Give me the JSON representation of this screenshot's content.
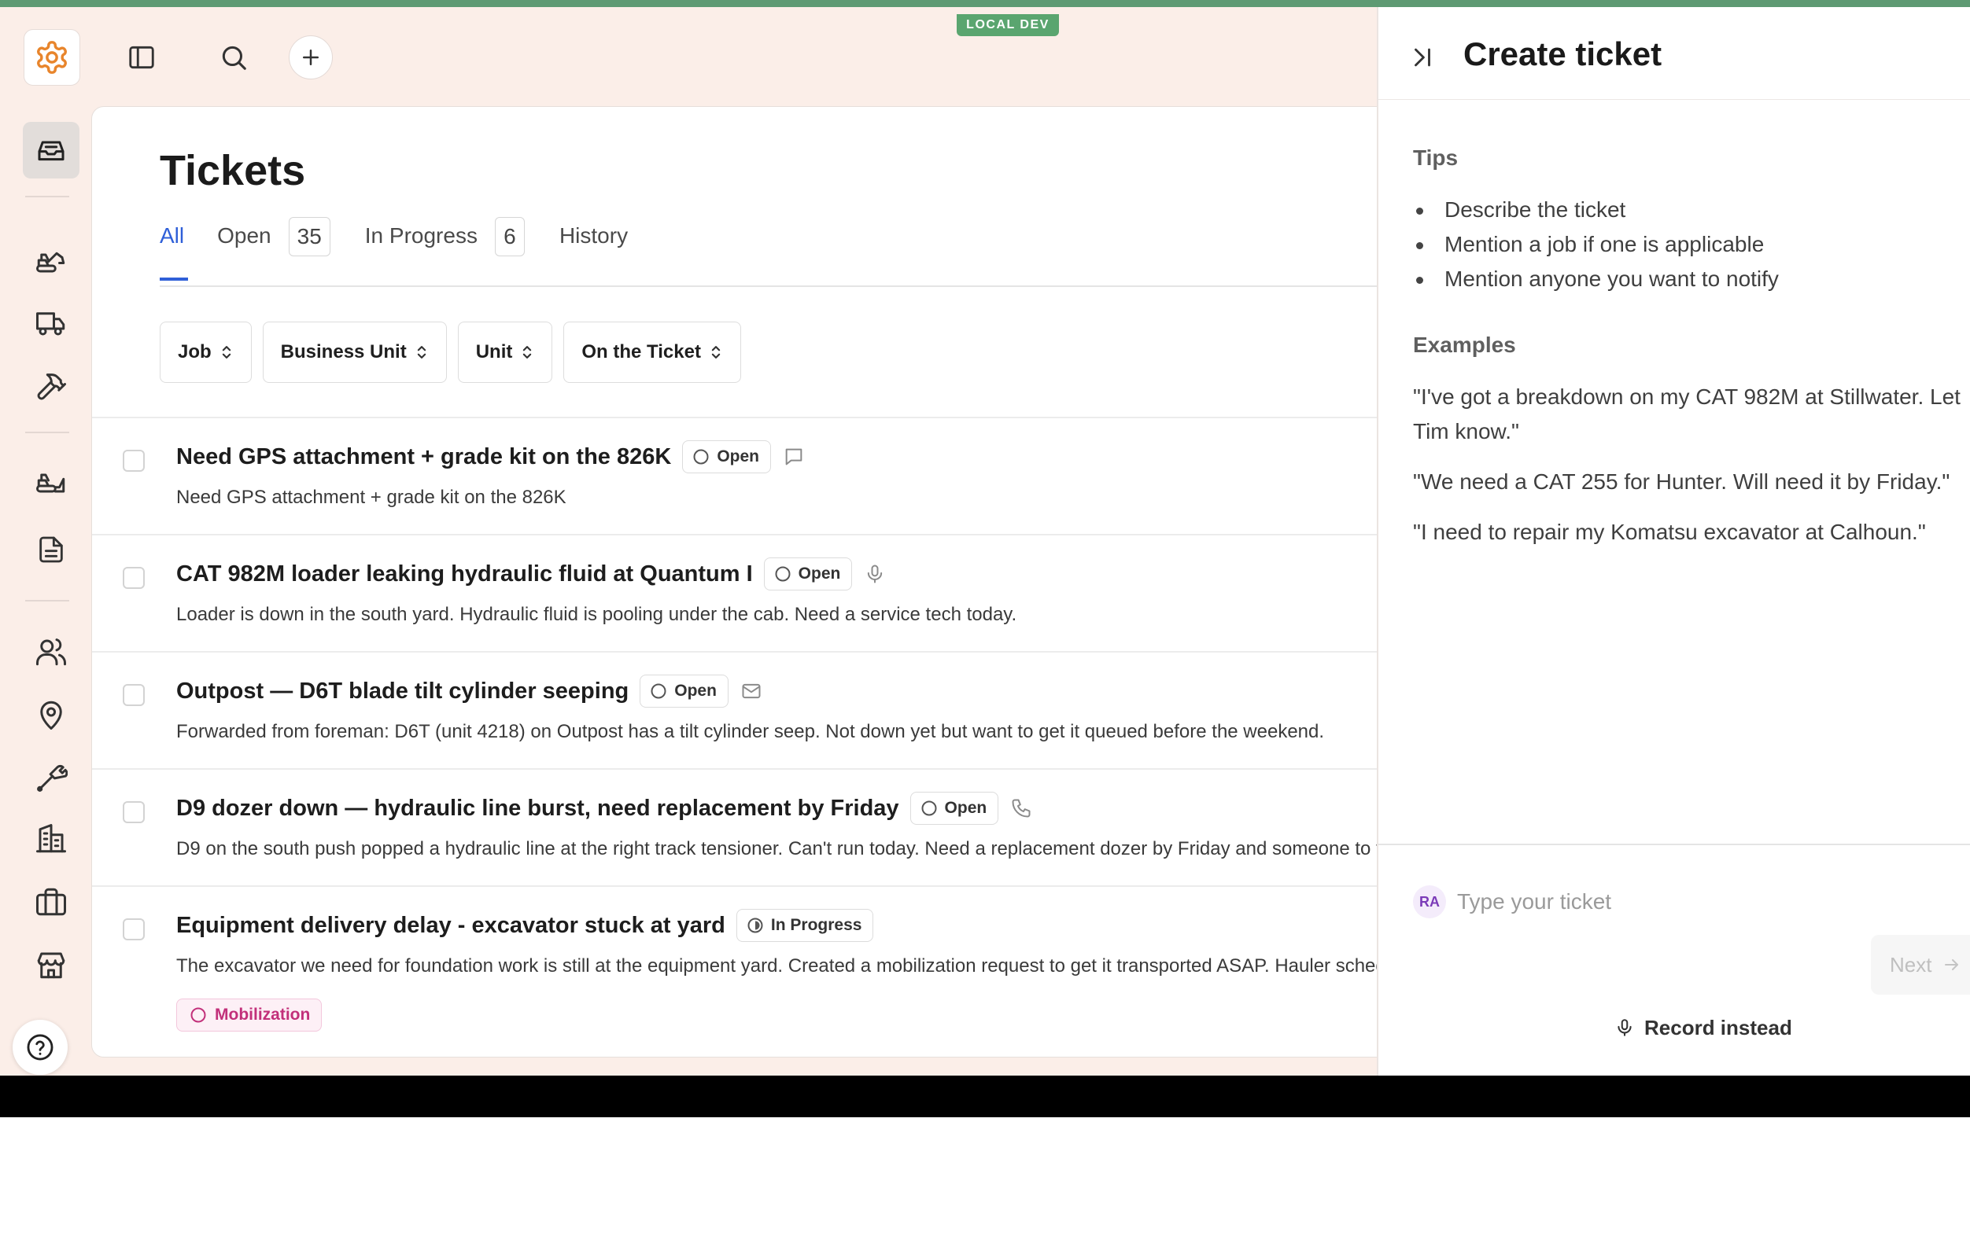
{
  "environment_badge": "LOCAL DEV",
  "toolbar": {
    "icons": [
      "gear-logo-icon",
      "sidebar-toggle-icon",
      "search-icon",
      "plus-icon"
    ]
  },
  "rail": {
    "items": [
      "inbox-icon",
      "excavator-icon",
      "truck-icon",
      "hammer-icon",
      "bulldozer-icon",
      "document-icon",
      "users-icon",
      "map-pin-icon",
      "wrench-icon",
      "building-icon",
      "briefcase-icon",
      "store-icon"
    ],
    "help_icon": "question-icon"
  },
  "main": {
    "title": "Tickets",
    "tabs": [
      {
        "label": "All",
        "count": ""
      },
      {
        "label": "Open",
        "count": "35"
      },
      {
        "label": "In Progress",
        "count": "6"
      },
      {
        "label": "History",
        "count": ""
      }
    ],
    "filters": [
      "Job",
      "Business Unit",
      "Unit",
      "On the Ticket"
    ],
    "tickets": [
      {
        "title": "Need GPS attachment + grade kit on the 826K",
        "status": "Open",
        "source": "chat-icon",
        "description": "Need GPS attachment + grade kit on the 826K",
        "tag": ""
      },
      {
        "title": "CAT 982M loader leaking hydraulic fluid at Quantum I",
        "status": "Open",
        "source": "microphone-icon",
        "description": "Loader is down in the south yard. Hydraulic fluid is pooling under the cab. Need a service tech today.",
        "tag": ""
      },
      {
        "title": "Outpost — D6T blade tilt cylinder seeping",
        "status": "Open",
        "source": "mail-icon",
        "description": "Forwarded from foreman: D6T (unit 4218) on Outpost has a tilt cylinder seep. Not down yet but want to get it queued before the weekend.",
        "tag": ""
      },
      {
        "title": "D9 dozer down — hydraulic line burst, need replacement by Friday",
        "status": "Open",
        "source": "phone-icon",
        "description": "D9 on the south push popped a hydraulic line at the right track tensioner. Can't run today. Need a replacement dozer by Friday and someone to fix it.",
        "tag": ""
      },
      {
        "title": "Equipment delivery delay - excavator stuck at yard",
        "status": "In Progress",
        "source": "",
        "description": "The excavator we need for foundation work is still at the equipment yard. Created a mobilization request to get it transported ASAP. Hauler scheduled.",
        "tag": "Mobilization"
      }
    ]
  },
  "drawer": {
    "title": "Create ticket",
    "tips_heading": "Tips",
    "tips": [
      "Describe the ticket",
      "Mention a job if one is applicable",
      "Mention anyone you want to notify"
    ],
    "examples_heading": "Examples",
    "examples": [
      "\"I've got a breakdown on my CAT 982M at Stillwater. Let Tim know.\"",
      "\"We need a CAT 255 for Hunter. Will need it by Friday.\"",
      "\"I need to repair my Komatsu excavator at Calhoun.\""
    ],
    "composer": {
      "avatar": "RA",
      "placeholder": "Type your ticket",
      "value": "",
      "next_label": "Next",
      "record_label": "Record instead"
    }
  },
  "colors": {
    "accent": "#2f5fd8",
    "env_badge": "#5aa56f",
    "frame_border": "#5e9a73",
    "logo": "#e8852c",
    "tag": "#c2307a"
  }
}
